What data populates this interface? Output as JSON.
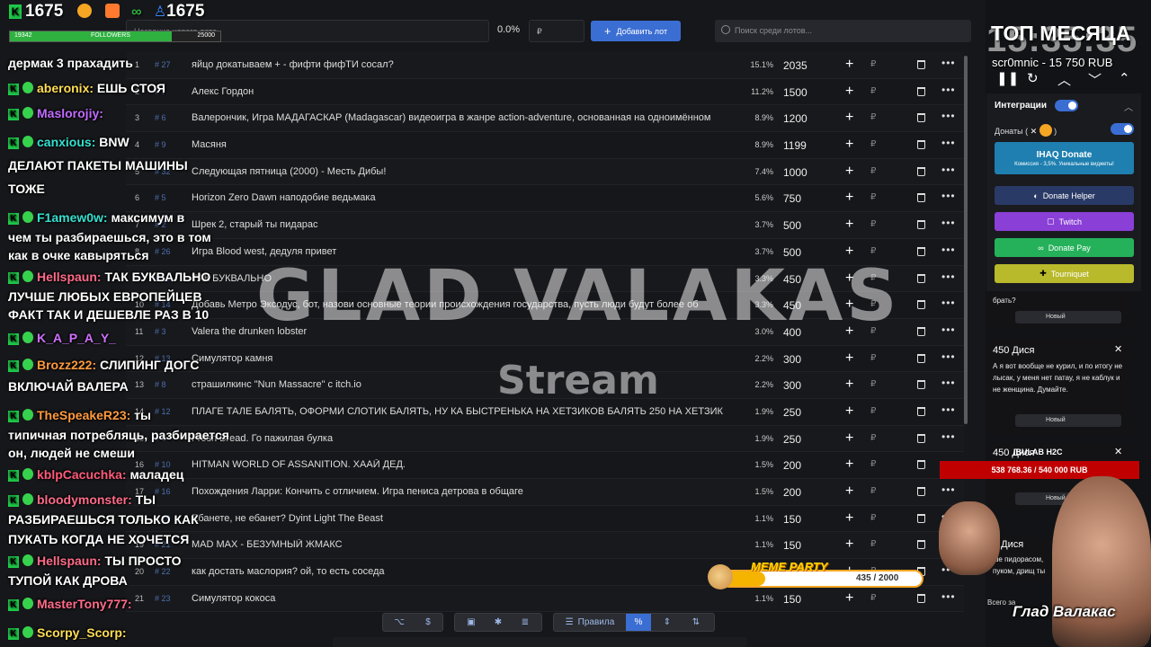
{
  "stats": {
    "points": "1675",
    "followers_count": "1675"
  },
  "followers_goal": {
    "current": "19342",
    "label": "FOLLOWERS",
    "target": "25000",
    "progress": 0.77
  },
  "toolbar": {
    "lot_name_placeholder": "Название нового лота",
    "percent": "0.0%",
    "price_placeholder": "₽",
    "add_lot": "Добавить лот",
    "search_placeholder": "Поиск среди лотов..."
  },
  "lots": [
    {
      "num": "1",
      "id": "# 27",
      "name": "яйцо докатываем + - фифти фифТИ сосал?",
      "pct": "15.1%",
      "amount": "2035"
    },
    {
      "num": "2",
      "id": "# 7",
      "name": "Алекс Гордон",
      "pct": "11.2%",
      "amount": "1500"
    },
    {
      "num": "3",
      "id": "# 6",
      "name": "Валерончик, Игра МАДАГАСКАР (Madagascar) видеоигра в жанре action-adventure, основанная на одноимённом",
      "pct": "8.9%",
      "amount": "1200"
    },
    {
      "num": "4",
      "id": "# 9",
      "name": "Масяня",
      "pct": "8.9%",
      "amount": "1199"
    },
    {
      "num": "5",
      "id": "# 32",
      "name": "Следующая пятница (2000) - Месть Дибы!",
      "pct": "7.4%",
      "amount": "1000"
    },
    {
      "num": "6",
      "id": "# 5",
      "name": "Horizon Zero Dawn наподобие ведьмака",
      "pct": "5.6%",
      "amount": "750"
    },
    {
      "num": "7",
      "id": "# 2",
      "name": "Шрек 2, старый ты пидарас",
      "pct": "3.7%",
      "amount": "500"
    },
    {
      "num": "8",
      "id": "# 26",
      "name": "Игра Blood west, дедуля привет",
      "pct": "3.7%",
      "amount": "500"
    },
    {
      "num": "9",
      "id": "# 11",
      "name": "ТАК БУКВАЛЬНО",
      "pct": "3.3%",
      "amount": "450"
    },
    {
      "num": "10",
      "id": "# 14",
      "name": "Добавь Метро Эксодус, бот, назови основные теории происхождения государства, пусть люди будут более об",
      "pct": "3.3%",
      "amount": "450"
    },
    {
      "num": "11",
      "id": "# 3",
      "name": "Valera the drunken lobster",
      "pct": "3.0%",
      "amount": "400"
    },
    {
      "num": "12",
      "id": "# 13",
      "name": "Симулятор камня",
      "pct": "2.2%",
      "amount": "300"
    },
    {
      "num": "13",
      "id": "# 8",
      "name": "страшилкинс \"Nun Massacre\" с itch.io",
      "pct": "2.2%",
      "amount": "300"
    },
    {
      "num": "14",
      "id": "# 12",
      "name": "ПЛАГЕ ТАЛЕ БАЛЯТЬ, ОФОРМИ СЛОТИК БАЛЯТЬ, НУ КА БЫСТРЕНЬКА НА ХЕТЗИКОВ БАЛЯТЬ 250 НА ХЕТЗИК",
      "pct": "1.9%",
      "amount": "250"
    },
    {
      "num": "15",
      "id": "# 4",
      "name": "Fresh Bread. Го пажилая булка",
      "pct": "1.9%",
      "amount": "250"
    },
    {
      "num": "16",
      "id": "# 10",
      "name": "HITMAN WORLD OF ASSANITION. ХААЙ ДЕД.",
      "pct": "1.5%",
      "amount": "200"
    },
    {
      "num": "17",
      "id": "# 16",
      "name": "Похождения Ларри: Кончить с отличием. Игра пениса детрова в общаге",
      "pct": "1.5%",
      "amount": "200"
    },
    {
      "num": "18",
      "id": "# 20",
      "name": "Ебанете, не ебанет? Dyint Light The Beast",
      "pct": "1.1%",
      "amount": "150"
    },
    {
      "num": "19",
      "id": "# 21",
      "name": "MAD MAX - БЕЗУМНЫЙ ЖМАКС",
      "pct": "1.1%",
      "amount": "150"
    },
    {
      "num": "20",
      "id": "# 22",
      "name": "как достать маслория? ой, то есть соседа",
      "pct": "",
      "amount": ""
    },
    {
      "num": "21",
      "id": "# 23",
      "name": "Симулятор кокоса",
      "pct": "1.1%",
      "amount": "150"
    }
  ],
  "rub_symbol": "₽",
  "bottom": {
    "rules": "Правила",
    "percent_sign": "%",
    "dollar": "$"
  },
  "chat": [
    {
      "user": "",
      "text": "дермак 3 прахадить",
      "color": "#ffffff",
      "badge": "none"
    },
    {
      "user": "aberonix:",
      "text": " ЕШЬ СТОЯ",
      "color": "#ffdd55",
      "badge": "k"
    },
    {
      "user": "Maslorojiy:",
      "text": "",
      "color": "#c06bff",
      "badge": "k"
    },
    {
      "user": "canxious:",
      "text": " BNW",
      "color": "#35e0d0",
      "badge": "k"
    },
    {
      "user": "",
      "text": "ДЕЛАЮТ ПАКЕТЫ     МАШИНЫ",
      "color": "#ffffff",
      "badge": "none"
    },
    {
      "user": "",
      "text": "ТОЖЕ",
      "color": "#ffffff",
      "badge": "none"
    },
    {
      "user": "F1amew0w:",
      "text": " максимум в",
      "color": "#35e0d0",
      "badge": "k"
    },
    {
      "user": "",
      "text": "чем ты разбираешься, это в том",
      "color": "#ffffff",
      "badge": "none"
    },
    {
      "user": "",
      "text": "как в очке кавыряться",
      "color": "#ffffff",
      "badge": "none"
    },
    {
      "user": "Hellspaun:",
      "text": " ТАК БУКВАЛЬНО",
      "color": "#ff6b8a",
      "badge": "k"
    },
    {
      "user": "",
      "text": "ЛУЧШЕ ЛЮБЫХ ЕВРОПЕЙЦЕВ",
      "color": "#ffffff",
      "badge": "none"
    },
    {
      "user": "",
      "text": "ФАКТ ТАК И ДЕШЕВЛЕ РАЗ В 10",
      "color": "#ffffff",
      "badge": "none"
    },
    {
      "user": "K_A_P_A_Y_",
      "text": "",
      "color": "#d070ff",
      "badge": "k"
    },
    {
      "user": "Brozz222:",
      "text": " СЛИПИНГ ДОГС",
      "color": "#ff9a3d",
      "badge": "k"
    },
    {
      "user": "",
      "text": "ВКЛЮЧАЙ ВАЛЕРА",
      "color": "#ffffff",
      "badge": "none"
    },
    {
      "user": "TheSpeakeR23:",
      "text": " ты",
      "color": "#ff9a3d",
      "badge": "k"
    },
    {
      "user": "",
      "text": "типичная потребляць, разбирается",
      "color": "#ffffff",
      "badge": "none"
    },
    {
      "user": "",
      "text": "он, людей не смеши",
      "color": "#ffffff",
      "badge": "none"
    },
    {
      "user": "kblpCacuchka:",
      "text": " маладец",
      "color": "#ff5a7a",
      "badge": "k"
    },
    {
      "user": "bloodymonster:",
      "text": " ТЫ",
      "color": "#ff6b8a",
      "badge": "k"
    },
    {
      "user": "",
      "text": "РАЗБИРАЕШЬСЯ ТОЛЬКО КАК",
      "color": "#ffffff",
      "badge": "none"
    },
    {
      "user": "",
      "text": "ПУКАТЬ КОГДА НЕ ХОЧЕТСЯ",
      "color": "#ffffff",
      "badge": "none"
    },
    {
      "user": "Hellspaun:",
      "text": " ТЫ ПРОСТО",
      "color": "#ff6b8a",
      "badge": "k"
    },
    {
      "user": "",
      "text": "ТУПОЙ КАК ДРОВА",
      "color": "#ffffff",
      "badge": "none"
    },
    {
      "user": "MasterTony777:",
      "text": "",
      "color": "#ff6b8a",
      "badge": "k"
    },
    {
      "user": "Scorpy_Scorp:",
      "text": "",
      "color": "#ffdd55",
      "badge": "k"
    }
  ],
  "watermark": {
    "title": "GLAD VALAKAS",
    "subtitle": "Stream"
  },
  "right": {
    "clock": "15:35:35",
    "top_month": "ТОП МЕСЯЦА",
    "top_user": "scr0mnic - 15 750 RUB",
    "integrations_title": "Интеграции",
    "donates_label": "Донаты (",
    "ihaq_title": "IHAQ Donate",
    "ihaq_sub": "Комиссия - 3,5%. Уникальные виджеты!",
    "donate_helper": "Donate Helper",
    "twitch": "Twitch",
    "donate_pay": "Donate Pay",
    "tourniquet": "Tourniquet"
  },
  "cards": [
    {
      "title": "",
      "text": "брать?",
      "select": "Новый"
    },
    {
      "title": "450 Дися",
      "text": "А я вот вообще не курил, и по итогу не лысак, у меня нет патау, я не каблук и не женщина. Думайте.",
      "select": "Новый"
    },
    {
      "title": "",
      "text": "",
      "select": "Новый"
    },
    {
      "title": "0 Дися",
      "text": "ше пидорасом, пуком, дрищ ты",
      "select": ""
    }
  ],
  "card_extra": {
    "name": "IBULAB H2C",
    "amount": "450 Дися",
    "total_label": "Всего за"
  },
  "goal": {
    "text": "538 768.36 / 540 000 RUB"
  },
  "meme": {
    "title": "MEME PARTY",
    "count": "435 / 2000",
    "progress": 0.2175
  },
  "glad_sign": "Глад Валакас"
}
